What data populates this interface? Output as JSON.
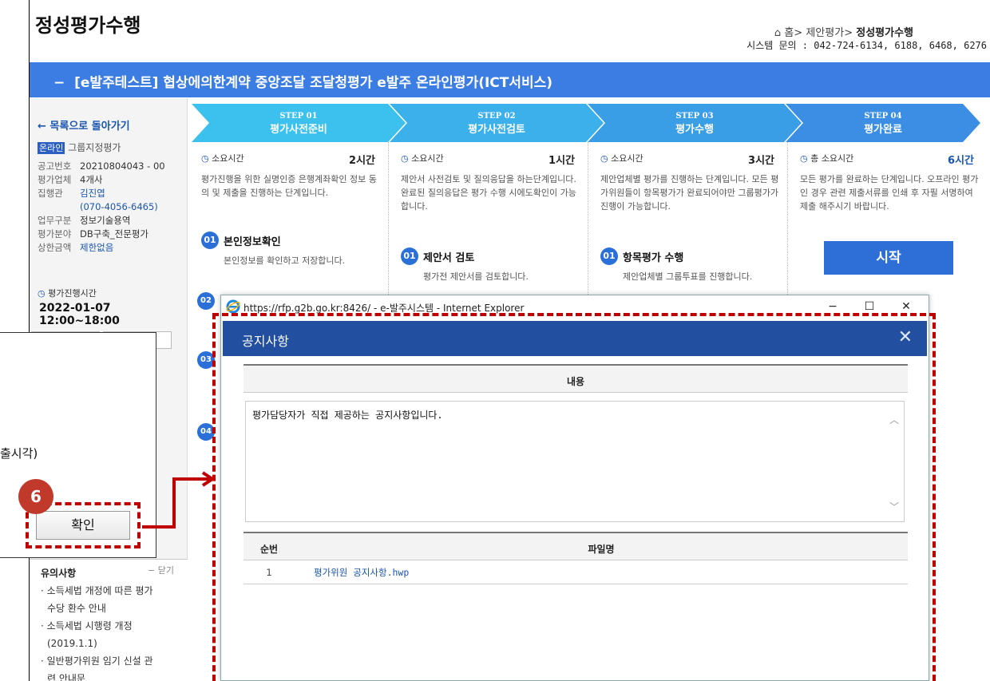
{
  "page": {
    "title": "정성평가수행",
    "breadcrumb": {
      "home": "홈",
      "sep": ">",
      "parent": "제안평가",
      "current": "정성평가수행"
    },
    "system_contact": "시스템 문의 : 042-724-6134, 6188, 6468, 6276"
  },
  "banner": {
    "prefix": "−",
    "text": "[e발주테스트] 협상에의한계약 중앙조달 조달청평가 e발주 온라인평가(ICT서비스)"
  },
  "sidebar": {
    "back_label": "← 목록으로 돌아가기",
    "online_badge": "온라인",
    "online_text": "그룹지정평가",
    "info": [
      {
        "k": "공고번호",
        "v": "20210804043 - 00"
      },
      {
        "k": "평가업체",
        "v": "4개사"
      },
      {
        "k": "집행관",
        "v": "김진엽",
        "v2": "(070-4056-6465)"
      },
      {
        "k": "업무구분",
        "v": "정보기술용역"
      },
      {
        "k": "평가분야",
        "v": "DB구축_전문평가"
      },
      {
        "k": "상한금액",
        "v": "제한없음"
      }
    ],
    "time_label": "평가진행시간",
    "time_value": "2022-01-07 12:00~18:00"
  },
  "notes": {
    "title": "유의사항",
    "close": "− 닫기",
    "items": [
      "소득세법 개정에 따른 평가",
      "수당 환수 안내",
      "소득세법 시행령 개정",
      "(2019.1.1)",
      "일반평가위원 임기 신설 관",
      "련 안내문"
    ]
  },
  "steps": [
    {
      "no": "STEP 01",
      "name": "평가사전준비",
      "dur_label": "소요시간",
      "hours": "2시간",
      "desc": "평가진행을 위한 실명인증 은행계좌확인 정보 동의 및 제출을 진행하는 단계입니다.",
      "task_no": "01",
      "task_title": "본인정보확인",
      "task_desc": "본인정보를 확인하고 저장합니다."
    },
    {
      "no": "STEP 02",
      "name": "평가사전검토",
      "dur_label": "소요시간",
      "hours": "1시간",
      "desc": "제안서 사전검토 및 질의응답을 하는단계입니다. 완료된 질의응답은 평가 수행 시에도확인이 가능합니다.",
      "task_no": "01",
      "task_title": "제안서 검토",
      "task_desc": "평가전 제안서를 검토합니다."
    },
    {
      "no": "STEP 03",
      "name": "평가수행",
      "dur_label": "소요시간",
      "hours": "3시간",
      "desc": "제안업체별 평가를 진행하는 단계입니다. 모든 평가위원들이 항목평가가 완료되어야만 그룹평가가 진행이 가능합니다.",
      "task_no": "01",
      "task_title": "항목평가 수행",
      "task_desc": "제안업체별 그룹투표를 진행합니다."
    },
    {
      "no": "STEP 04",
      "name": "평가완료",
      "dur_label": "총 소요시간",
      "hours": "6시간",
      "desc": "모든 평가를 완료하는 단계입니다. 오프라인 평가인 경우 관련 제출서류를 인쇄 후 자필 서명하여 제출 해주시기 바랍니다."
    }
  ],
  "start_label": "시작",
  "side_circles": [
    "02",
    "03",
    "04"
  ],
  "callout": {
    "text": "출시각)",
    "badge": "6",
    "confirm_label": "확인"
  },
  "ie_window": {
    "title": "https://rfp.g2b.go.kr:8426/ - e-발주시스템 - Internet Explorer",
    "minimize": "−",
    "maximize": "☐",
    "close": "✕"
  },
  "modal": {
    "title": "공지사항",
    "close": "✕",
    "content_header": "내용",
    "content_text": "평가담당자가 직접 제공하는 공지사항입니다.",
    "table": {
      "headers": [
        "순번",
        "파일명"
      ],
      "rows": [
        {
          "no": "1",
          "file": "평가위원 공지사항.hwp"
        }
      ]
    }
  },
  "colors": {
    "accent": "#3b7de3",
    "modal_header": "#224fa0",
    "callout_red": "#c00000",
    "badge_red": "#c0392b"
  }
}
